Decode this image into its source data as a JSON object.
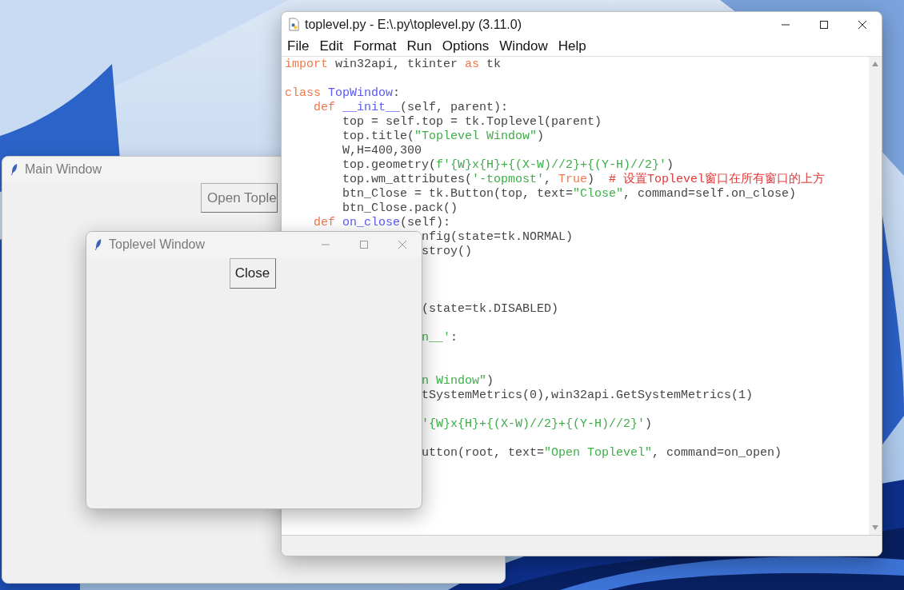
{
  "main_window": {
    "title": "Main Window",
    "button": "Open Tople"
  },
  "editor_window": {
    "title": "toplevel.py - E:\\.py\\toplevel.py (3.11.0)",
    "menu": [
      "File",
      "Edit",
      "Format",
      "Run",
      "Options",
      "Window",
      "Help"
    ],
    "lines": [
      {
        "kind": "code",
        "segments": [
          {
            "text": "import",
            "kind": "keyword"
          },
          {
            "text": " win32api, tkinter ",
            "kind": "plain"
          },
          {
            "text": "as",
            "kind": "keyword"
          },
          {
            "text": " tk",
            "kind": "plain"
          }
        ]
      },
      {
        "kind": "blank"
      },
      {
        "kind": "code",
        "segments": [
          {
            "text": "class ",
            "kind": "keyword"
          },
          {
            "text": "TopWindow",
            "kind": "definition"
          },
          {
            "text": ":",
            "kind": "plain"
          }
        ]
      },
      {
        "kind": "code",
        "segments": [
          {
            "text": "    def ",
            "kind": "keyword"
          },
          {
            "text": "__init__",
            "kind": "definition"
          },
          {
            "text": "(self, parent):",
            "kind": "plain"
          }
        ]
      },
      {
        "kind": "code",
        "segments": [
          {
            "text": "        top = self.top = tk.Toplevel(parent)",
            "kind": "plain"
          }
        ]
      },
      {
        "kind": "code",
        "segments": [
          {
            "text": "        top.title(",
            "kind": "plain"
          },
          {
            "text": "\"Toplevel Window\"",
            "kind": "string"
          },
          {
            "text": ")",
            "kind": "plain"
          }
        ]
      },
      {
        "kind": "code",
        "segments": [
          {
            "text": "        W,H=400,300",
            "kind": "plain"
          }
        ]
      },
      {
        "kind": "code",
        "segments": [
          {
            "text": "        top.geometry(",
            "kind": "plain"
          },
          {
            "text": "f'{W}x{H}+{(X-W)//2}+{(Y-H)//2}'",
            "kind": "string"
          },
          {
            "text": ")",
            "kind": "plain"
          }
        ]
      },
      {
        "kind": "code",
        "segments": [
          {
            "text": "        top.wm_attributes(",
            "kind": "plain"
          },
          {
            "text": "'-topmost'",
            "kind": "string"
          },
          {
            "text": ", ",
            "kind": "plain"
          },
          {
            "text": "True",
            "kind": "keyword"
          },
          {
            "text": ")  ",
            "kind": "plain"
          },
          {
            "text": "# 设置Toplevel窗口在所有窗口的上方",
            "kind": "comment"
          }
        ]
      },
      {
        "kind": "code",
        "segments": [
          {
            "text": "        btn_Close = tk.Button(top, text=",
            "kind": "plain"
          },
          {
            "text": "\"Close\"",
            "kind": "string"
          },
          {
            "text": ", command=self.on_close)",
            "kind": "plain"
          }
        ]
      },
      {
        "kind": "code",
        "segments": [
          {
            "text": "        btn_Close.pack()",
            "kind": "plain"
          }
        ]
      },
      {
        "kind": "code",
        "segments": [
          {
            "text": "    def ",
            "kind": "keyword"
          },
          {
            "text": "on_close",
            "kind": "definition"
          },
          {
            "text": "(self):",
            "kind": "plain"
          }
        ]
      },
      {
        "kind": "clipped",
        "segments": [
          {
            "text": "nfig(state=tk.NORMAL)",
            "kind": "plain"
          }
        ]
      },
      {
        "kind": "clipped",
        "segments": [
          {
            "text": "stroy()",
            "kind": "plain"
          }
        ]
      },
      {
        "kind": "blank"
      },
      {
        "kind": "blank"
      },
      {
        "kind": "blank"
      },
      {
        "kind": "clipped",
        "segments": [
          {
            "text": "(state=tk.DISABLED)",
            "kind": "plain"
          }
        ]
      },
      {
        "kind": "blank"
      },
      {
        "kind": "clipped",
        "segments": [
          {
            "text": "n__'",
            "kind": "string"
          },
          {
            "text": ":",
            "kind": "plain"
          }
        ]
      },
      {
        "kind": "blank"
      },
      {
        "kind": "blank"
      },
      {
        "kind": "clipped",
        "segments": [
          {
            "text": "n Window\"",
            "kind": "string"
          },
          {
            "text": ")",
            "kind": "plain"
          }
        ]
      },
      {
        "kind": "clipped",
        "segments": [
          {
            "text": "tSystemMetrics(0),win32api.GetSystemMetrics(1)",
            "kind": "plain"
          }
        ]
      },
      {
        "kind": "blank"
      },
      {
        "kind": "clipped",
        "segments": [
          {
            "text": "'{W}x{H}+{(X-W)//2}+{(Y-H)//2}'",
            "kind": "string"
          },
          {
            "text": ")",
            "kind": "plain"
          }
        ]
      },
      {
        "kind": "blank"
      },
      {
        "kind": "clipped",
        "segments": [
          {
            "text": "utton(root, text=",
            "kind": "plain"
          },
          {
            "text": "\"Open Toplevel\"",
            "kind": "string"
          },
          {
            "text": ", command=on_open)",
            "kind": "plain"
          }
        ]
      }
    ]
  },
  "toplevel_window": {
    "title": "Toplevel Window",
    "button": "Close"
  }
}
